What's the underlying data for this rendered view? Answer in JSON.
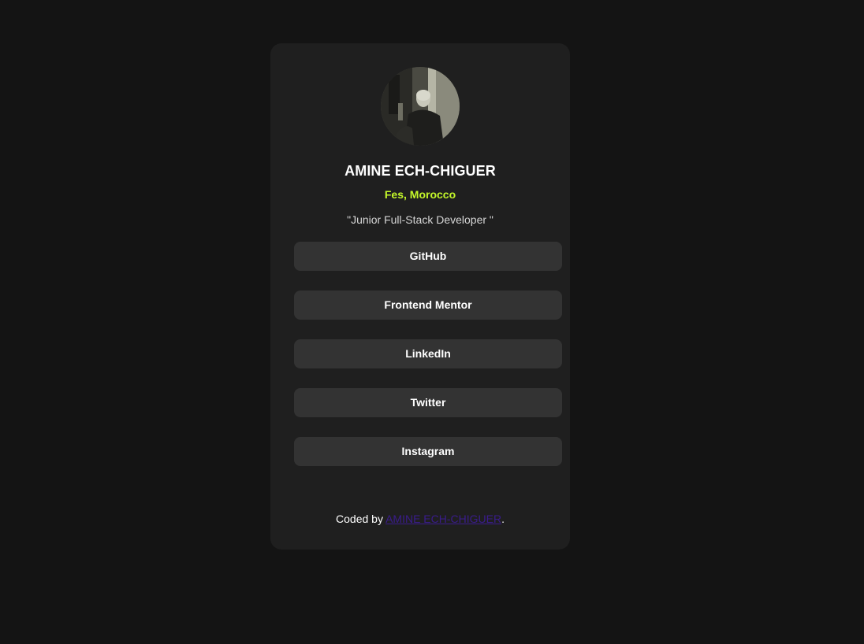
{
  "profile": {
    "name": "AMINE ECH-CHIGUER",
    "location": "Fes, Morocco",
    "bio": "\"Junior Full-Stack Developer \""
  },
  "links": [
    {
      "label": "GitHub"
    },
    {
      "label": "Frontend Mentor"
    },
    {
      "label": "LinkedIn"
    },
    {
      "label": "Twitter"
    },
    {
      "label": "Instagram"
    }
  ],
  "footer": {
    "prefix": "Coded by ",
    "author": "AMINE ECH-CHIGUER",
    "suffix": "."
  },
  "colors": {
    "page_background": "#141414",
    "card_background": "#1f1f1f",
    "button_background": "#333333",
    "accent": "#c4f82a",
    "footer_link": "#3a1c8c"
  }
}
